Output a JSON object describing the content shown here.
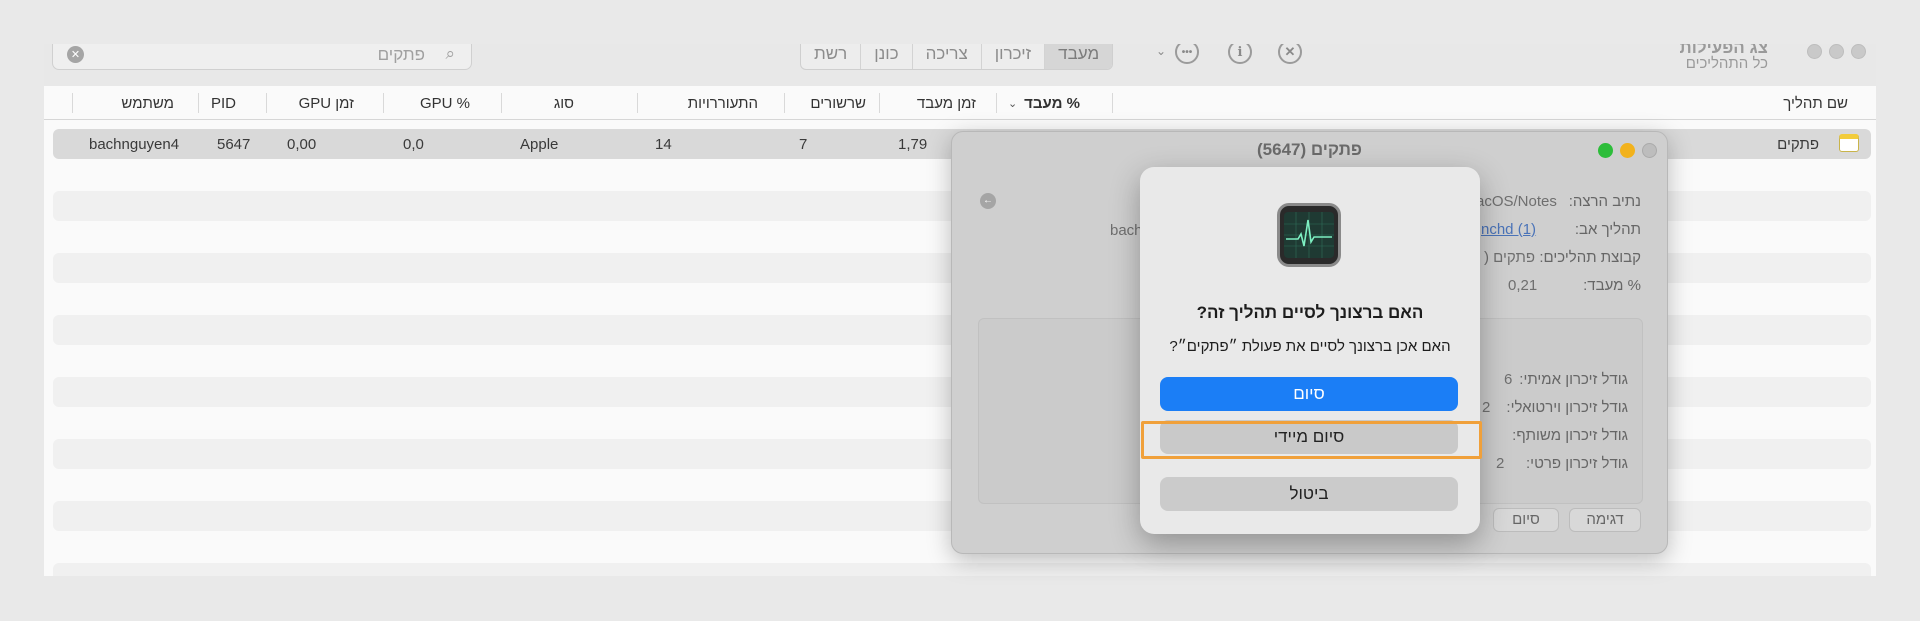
{
  "app": {
    "title": "צג הפעילות",
    "subtitle": "כל התהליכים"
  },
  "toolbar": {
    "tabs": [
      "מעבד",
      "זיכרון",
      "צריכה",
      "כונן",
      "רשת"
    ],
    "active_tab": "מעבד",
    "search_value": "פתקים",
    "icons": [
      "close-circle-icon",
      "info-icon",
      "more-icon",
      "chevron-down-icon"
    ]
  },
  "table": {
    "columns": [
      "שם תהליך",
      "% מעבד",
      "זמן מעבד",
      "שרשורים",
      "התעוררויות",
      "סוג",
      "% GPU",
      "זמן GPU",
      "PID",
      "משתמש"
    ],
    "rows": [
      {
        "name": "פתקים",
        "cpu_time": "1,79",
        "threads": "7",
        "wakeups": "14",
        "kind": "Apple",
        "gpu": "0,0",
        "gpu_time": "0,00",
        "pid": "5647",
        "user": "bachnguyen4"
      }
    ]
  },
  "info_window": {
    "title": "פתקים (5647)",
    "fields": [
      {
        "label": "נתיב הרצה:",
        "value": "acOS/Notes"
      },
      {
        "label": "תהליך אב:",
        "value": "nchd (1)"
      },
      {
        "label": "קבוצת תהליכים:",
        "value": "פתקים ("
      },
      {
        "label": "% מעבד:",
        "value": "0,21"
      }
    ],
    "partial_left": "bach",
    "memory": [
      {
        "label": "גודל זיכרון אמיתי:",
        "value": "6"
      },
      {
        "label": "גודל זיכרון וירטואלי:",
        "value": "2"
      },
      {
        "label": "גודל זיכרון משותף:",
        "value": ""
      },
      {
        "label": "גודל זיכרון פרטי:",
        "value": "2"
      }
    ],
    "buttons": [
      "דגימה",
      "סיום"
    ]
  },
  "dialog": {
    "heading": "האם ברצונך לסיים תהליך זה?",
    "message": "האם אכן ברצונך לסיים את פעולת ״פתקים״?",
    "quit": "סיום",
    "force_quit": "סיום מיידי",
    "cancel": "ביטול"
  },
  "colors": {
    "accent": "#1b7ef6",
    "highlight": "#f0a03a"
  }
}
